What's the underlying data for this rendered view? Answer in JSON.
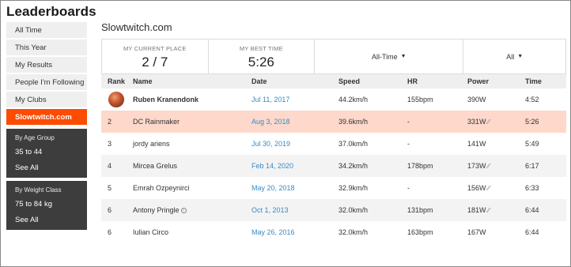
{
  "page": {
    "title": "Leaderboards"
  },
  "sidebar": {
    "items": [
      {
        "label": "All Time"
      },
      {
        "label": "This Year"
      },
      {
        "label": "My Results"
      },
      {
        "label": "People I'm Following"
      },
      {
        "label": "My Clubs"
      },
      {
        "label": "Slowtwitch.com"
      }
    ],
    "age_group": {
      "heading": "By Age Group",
      "selected": "35 to 44",
      "see_all": "See All"
    },
    "weight_class": {
      "heading": "By Weight Class",
      "selected": "75 to 84 kg",
      "see_all": "See All"
    }
  },
  "main": {
    "club_name": "Slowtwitch.com",
    "stats": {
      "place_label": "MY CURRENT PLACE",
      "place_value": "2 / 7",
      "best_label": "MY BEST TIME",
      "best_value": "5:26"
    },
    "filters": {
      "time_range": "All-Time",
      "category": "All"
    }
  },
  "table": {
    "headers": {
      "rank": "Rank",
      "name": "Name",
      "date": "Date",
      "speed": "Speed",
      "hr": "HR",
      "power": "Power",
      "time": "Time"
    },
    "rows": [
      {
        "rank": "",
        "name": "Ruben Kranendonk",
        "date": "Jul 11, 2017",
        "speed": "44.2km/h",
        "hr": "155bpm",
        "power": "390W",
        "time": "4:52"
      },
      {
        "rank": "2",
        "name": "DC Rainmaker",
        "date": "Aug 3, 2018",
        "speed": "39.6km/h",
        "hr": "-",
        "power": "331W",
        "time": "5:26"
      },
      {
        "rank": "3",
        "name": "jordy ariens",
        "date": "Jul 30, 2019",
        "speed": "37.0km/h",
        "hr": "-",
        "power": "141W",
        "time": "5:49"
      },
      {
        "rank": "4",
        "name": "Mircea Grelus",
        "date": "Feb 14, 2020",
        "speed": "34.2km/h",
        "hr": "178bpm",
        "power": "173W",
        "time": "6:17"
      },
      {
        "rank": "5",
        "name": "Emrah Ozpeynirci",
        "date": "May 20, 2018",
        "speed": "32.9km/h",
        "hr": "-",
        "power": "156W",
        "time": "6:33"
      },
      {
        "rank": "6",
        "name": "Antony Pringle",
        "date": "Oct 1, 2013",
        "speed": "32.0km/h",
        "hr": "131bpm",
        "power": "181W",
        "time": "6:44"
      },
      {
        "rank": "6",
        "name": "Iulian Circo",
        "date": "May 26, 2016",
        "speed": "32.0km/h",
        "hr": "163bpm",
        "power": "167W",
        "time": "6:44"
      }
    ]
  }
}
